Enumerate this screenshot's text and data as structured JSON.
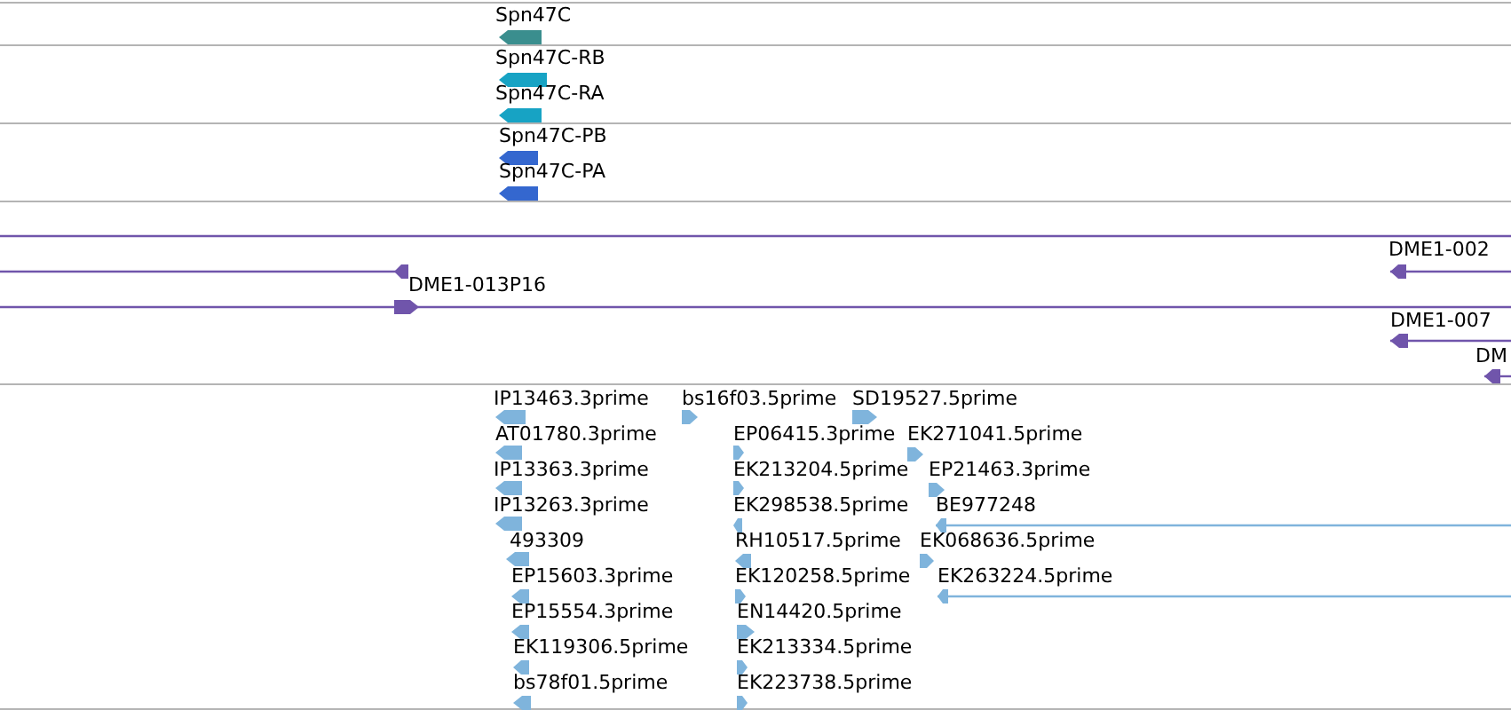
{
  "tracks": [
    {
      "color": "#3a8e8e",
      "features": [
        {
          "label": "Spn47C",
          "kind": "reverse"
        }
      ]
    },
    {
      "color": "#17a3c4",
      "features": [
        {
          "label": "Spn47C-RB",
          "kind": "reverse"
        },
        {
          "label": "Spn47C-RA",
          "kind": "reverse"
        }
      ]
    },
    {
      "color": "#3467cf",
      "features": [
        {
          "label": "Spn47C-PB",
          "kind": "reverse"
        },
        {
          "label": "Spn47C-PA",
          "kind": "reverse"
        }
      ]
    },
    {
      "color": "#7055ab",
      "features": [
        {
          "kind": "line"
        },
        {
          "kind": "reverse"
        },
        {
          "label": "DME1-013P16",
          "kind": "forward"
        },
        {
          "label": "DME1-002",
          "kind": "reverse"
        },
        {
          "label": "DME1-007",
          "kind": "reverse"
        },
        {
          "label": "DM",
          "kind": "reverse"
        }
      ]
    },
    {
      "color": "#7fb4dc",
      "features": [
        {
          "label": "IP13463.3prime",
          "kind": "reverse"
        },
        {
          "label": "AT01780.3prime",
          "kind": "reverse"
        },
        {
          "label": "IP13363.3prime",
          "kind": "reverse"
        },
        {
          "label": "IP13263.3prime",
          "kind": "reverse"
        },
        {
          "label": "493309",
          "kind": "reverse"
        },
        {
          "label": "EP15603.3prime",
          "kind": "reverse"
        },
        {
          "label": "EP15554.3prime",
          "kind": "reverse"
        },
        {
          "label": "EK119306.5prime",
          "kind": "reverse"
        },
        {
          "label": "bs78f01.5prime",
          "kind": "reverse"
        },
        {
          "label": "bs16f03.5prime",
          "kind": "forward"
        },
        {
          "label": "EP06415.3prime",
          "kind": "forward"
        },
        {
          "label": "EK213204.5prime",
          "kind": "forward"
        },
        {
          "label": "EK298538.5prime",
          "kind": "reverse"
        },
        {
          "label": "RH10517.5prime",
          "kind": "reverse"
        },
        {
          "label": "EK120258.5prime",
          "kind": "forward"
        },
        {
          "label": "EN14420.5prime",
          "kind": "forward"
        },
        {
          "label": "EK213334.5prime",
          "kind": "forward"
        },
        {
          "label": "EK223738.5prime",
          "kind": "forward"
        },
        {
          "label": "SD19527.5prime",
          "kind": "forward"
        },
        {
          "label": "EK271041.5prime",
          "kind": "forward"
        },
        {
          "label": "EP21463.3prime",
          "kind": "forward"
        },
        {
          "label": "BE977248",
          "kind": "reverse"
        },
        {
          "label": "EK068636.5prime",
          "kind": "forward"
        },
        {
          "label": "EK263224.5prime",
          "kind": "reverse"
        }
      ]
    }
  ]
}
